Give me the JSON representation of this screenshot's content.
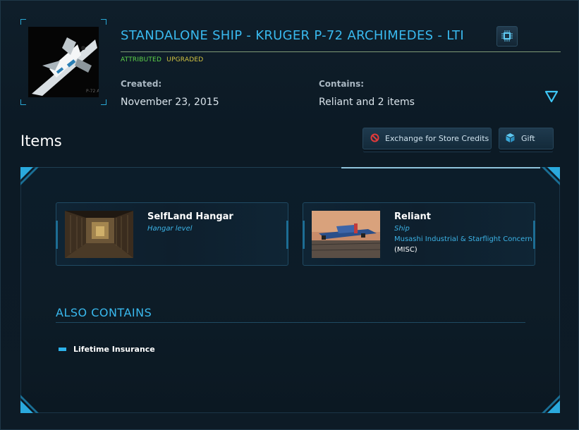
{
  "pledge": {
    "title": "STANDALONE SHIP - KRUGER P-72 ARCHIMEDES - LTI",
    "tags": {
      "attributed": "ATTRIBUTED",
      "upgraded": "UPGRADED"
    },
    "created_label": "Created:",
    "created_value": "November 23, 2015",
    "contains_label": "Contains:",
    "contains_value": "Reliant and 2 items"
  },
  "items_section": {
    "heading": "Items",
    "exchange_label": "Exchange for Store Credits",
    "gift_label": "Gift"
  },
  "items": [
    {
      "title": "SelfLand Hangar",
      "subtitle": "Hangar level"
    },
    {
      "title": "Reliant",
      "subtitle": "Ship",
      "manufacturer": "Musashi Industrial & Starflight Concern",
      "code": "(MISC)"
    }
  ],
  "also_contains": {
    "heading": "ALSO CONTAINS",
    "items": [
      "Lifetime Insurance"
    ]
  },
  "colors": {
    "accent": "#39b9ee",
    "attributed": "#5fd44b",
    "upgraded": "#d2c341"
  },
  "icons": {
    "chip": "microchip-icon",
    "expand": "triangle-down-icon",
    "exchange": "no-entry-icon",
    "gift": "gift-cube-icon"
  }
}
